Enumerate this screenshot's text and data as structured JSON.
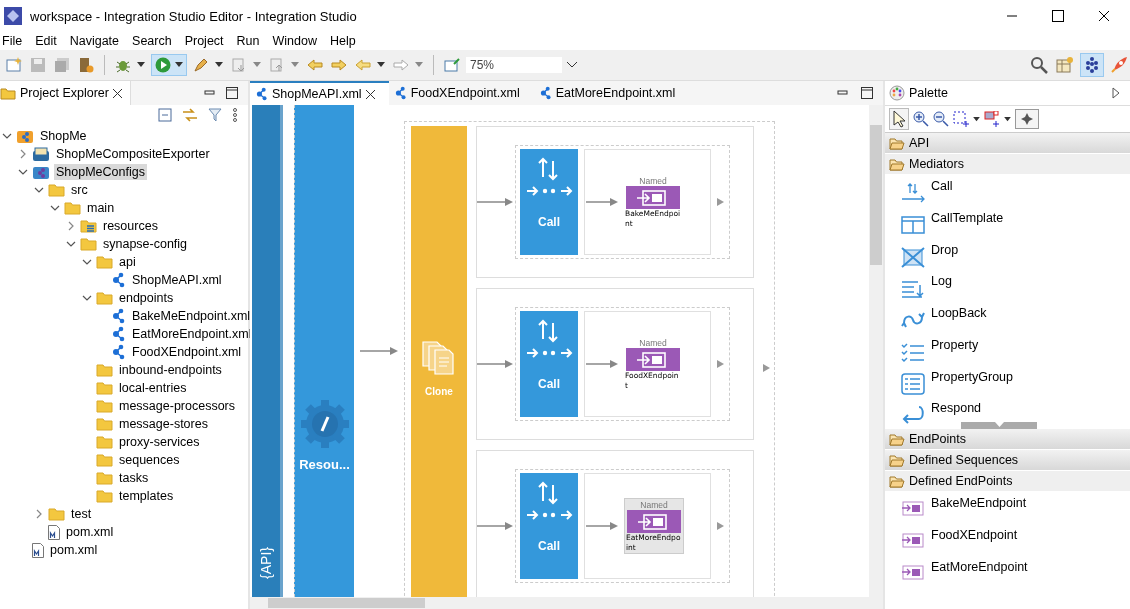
{
  "window": {
    "title": "workspace - Integration Studio Editor - Integration Studio"
  },
  "menu": [
    "File",
    "Edit",
    "Navigate",
    "Search",
    "Project",
    "Run",
    "Window",
    "Help"
  ],
  "toolbar": {
    "zoom": "75%"
  },
  "explorer": {
    "title": "Project Explorer",
    "tree": [
      {
        "label": "ShopMe",
        "kind": "project",
        "expanded": true,
        "selected": false,
        "children": [
          {
            "label": "ShopMeCompositeExporter",
            "kind": "exporter",
            "expanded": false,
            "selected": false
          },
          {
            "label": "ShopMeConfigs",
            "kind": "configs",
            "expanded": true,
            "selected": true,
            "children": [
              {
                "label": "src",
                "kind": "folder",
                "expanded": true,
                "selected": false,
                "children": [
                  {
                    "label": "main",
                    "kind": "folder",
                    "expanded": true,
                    "selected": false,
                    "children": [
                      {
                        "label": "resources",
                        "kind": "resources",
                        "expanded": false,
                        "selected": false
                      },
                      {
                        "label": "synapse-config",
                        "kind": "folder",
                        "expanded": true,
                        "selected": false,
                        "children": [
                          {
                            "label": "api",
                            "kind": "folder",
                            "expanded": true,
                            "selected": false,
                            "children": [
                              {
                                "label": "ShopMeAPI.xml",
                                "kind": "xml",
                                "selected": false
                              }
                            ]
                          },
                          {
                            "label": "endpoints",
                            "kind": "folder",
                            "expanded": true,
                            "selected": false,
                            "children": [
                              {
                                "label": "BakeMeEndpoint.xml",
                                "kind": "xml",
                                "selected": false
                              },
                              {
                                "label": "EatMoreEndpoint.xml",
                                "kind": "xml",
                                "selected": false
                              },
                              {
                                "label": "FoodXEndpoint.xml",
                                "kind": "xml",
                                "selected": false
                              }
                            ]
                          },
                          {
                            "label": "inbound-endpoints",
                            "kind": "folder",
                            "selected": false
                          },
                          {
                            "label": "local-entries",
                            "kind": "folder",
                            "selected": false
                          },
                          {
                            "label": "message-processors",
                            "kind": "folder",
                            "selected": false
                          },
                          {
                            "label": "message-stores",
                            "kind": "folder",
                            "selected": false
                          },
                          {
                            "label": "proxy-services",
                            "kind": "folder",
                            "selected": false
                          },
                          {
                            "label": "sequences",
                            "kind": "folder",
                            "selected": false
                          },
                          {
                            "label": "tasks",
                            "kind": "folder",
                            "selected": false
                          },
                          {
                            "label": "templates",
                            "kind": "folder",
                            "selected": false
                          }
                        ]
                      }
                    ]
                  }
                ]
              },
              {
                "label": "test",
                "kind": "folder",
                "expanded": false,
                "selected": false
              },
              {
                "label": "pom.xml",
                "kind": "pom",
                "selected": false
              }
            ]
          },
          {
            "label": "pom.xml",
            "kind": "pom",
            "selected": false
          }
        ]
      }
    ]
  },
  "editor_tabs": [
    {
      "label": "ShopMeAPI.xml",
      "selected": true
    },
    {
      "label": "FoodXEndpoint.xml",
      "selected": false
    },
    {
      "label": "EatMoreEndpoint.xml",
      "selected": false
    }
  ],
  "diagram": {
    "api_label": "{API}",
    "resource": "Resou...",
    "clone": "Clone",
    "branches": [
      {
        "mediator": "Call",
        "tag": "Named",
        "endpoint": "BakeMeEndpoint",
        "selected": false
      },
      {
        "mediator": "Call",
        "tag": "Named",
        "endpoint": "FoodXEndpoint",
        "selected": false
      },
      {
        "mediator": "Call",
        "tag": "Named",
        "endpoint": "EatMoreEndpoint",
        "selected": true
      }
    ]
  },
  "palette": {
    "title": "Palette",
    "sections": [
      {
        "label": "API",
        "expanded": false
      },
      {
        "label": "Mediators",
        "expanded": true,
        "items": [
          {
            "label": "Call",
            "kind": "call"
          },
          {
            "label": "CallTemplate",
            "kind": "calltemplate"
          },
          {
            "label": "Drop",
            "kind": "drop"
          },
          {
            "label": "Log",
            "kind": "log"
          },
          {
            "label": "LoopBack",
            "kind": "loopback"
          },
          {
            "label": "Property",
            "kind": "property"
          },
          {
            "label": "PropertyGroup",
            "kind": "propertygroup"
          },
          {
            "label": "Respond",
            "kind": "respond"
          }
        ]
      },
      {
        "label": "EndPoints",
        "expanded": false
      },
      {
        "label": "Defined Sequences",
        "expanded": false
      },
      {
        "label": "Defined EndPoints",
        "expanded": true,
        "items": [
          {
            "label": "BakeMeEndpoint",
            "kind": "endpoint"
          },
          {
            "label": "FoodXEndpoint",
            "kind": "endpoint"
          },
          {
            "label": "EatMoreEndpoint",
            "kind": "endpoint"
          }
        ]
      }
    ]
  }
}
